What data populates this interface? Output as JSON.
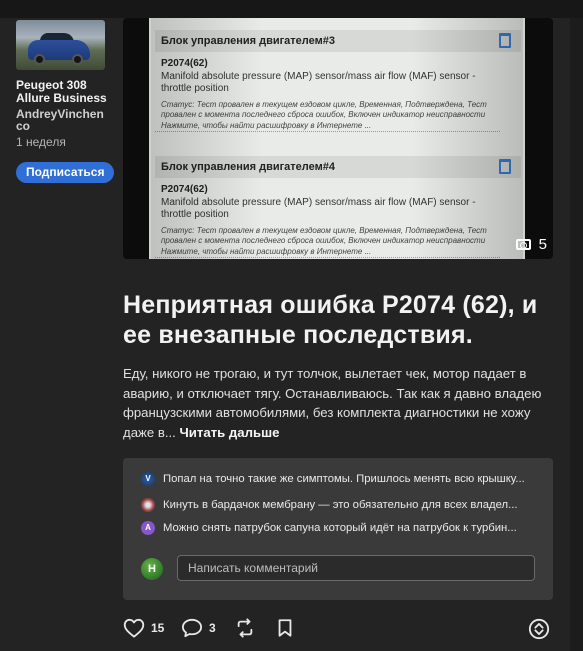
{
  "author": {
    "car_name": "Peugeot 308 Allure Business",
    "owner": "AndreyVinchenco",
    "time_ago": "1 неделя",
    "subscribe_label": "Подписаться"
  },
  "photo": {
    "count": "5",
    "blocks": [
      {
        "header": "Блок управления двигателем#3",
        "code": "P2074(62)",
        "desc": "Manifold absolute pressure (MAP) sensor/mass air flow (MAF) sensor - throttle position",
        "status": "Статус: Тест провален в текущем ездовом цикле, Временная, Подтверждена, Тест провален с момента последнего сброса ошибок, Включен индикатор неисправности",
        "link": "Нажмите, чтобы найти расшифровку в Интернете ..."
      },
      {
        "header": "Блок управления двигателем#4",
        "code": "P2074(62)",
        "desc": "Manifold absolute pressure (MAP) sensor/mass air flow (MAF) sensor - throttle position",
        "status": "Статус: Тест провален в текущем ездовом цикле, Временная, Подтверждена, Тест провален с момента последнего сброса ошибок, Включен индикатор неисправности",
        "link": "Нажмите, чтобы найти расшифровку в Интернете ..."
      }
    ]
  },
  "post": {
    "title": "Неприятная ошибка P2074 (62), и ее внезапные последствия.",
    "excerpt": "Еду, никого не трогаю, и тут толчок, вылетает чек, мотор падает в аварию, и отключает тягу. Останавливаюсь. Так как я давно владею французскими автомобилями, без комплекта диагностики не хожу даже в...",
    "read_more": "Читать дальше"
  },
  "comments": {
    "items": [
      {
        "avatar": "V",
        "text": "Попал на точно такие же симптомы. Пришлось менять всю крышку..."
      },
      {
        "avatar": "",
        "text": "Кинуть в бардачок мембрану — это обязательно для всех владел..."
      },
      {
        "avatar": "A",
        "text": "Можно снять патрубок сапуна который идёт на патрубок к турбин..."
      }
    ],
    "my_avatar": "Н",
    "placeholder": "Написать комментарий"
  },
  "actions": {
    "likes": "15",
    "comments": "3"
  },
  "colors": {
    "accent": "#2f6fd6",
    "background": "#232323",
    "comment_box": "#3a3a3a"
  }
}
